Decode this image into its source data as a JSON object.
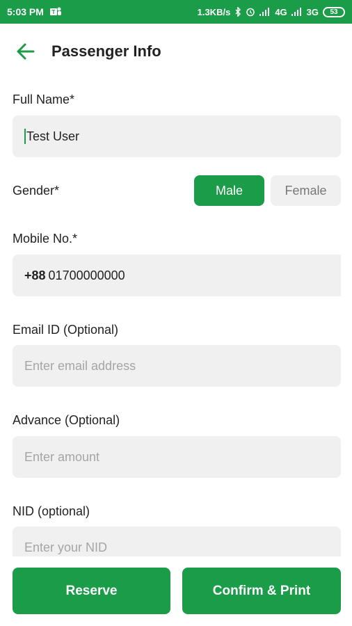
{
  "status_bar": {
    "time": "5:03 PM",
    "net_speed": "1.3KB/s",
    "net1": "4G",
    "net2": "3G",
    "battery": "53"
  },
  "header": {
    "title": "Passenger Info"
  },
  "form": {
    "full_name": {
      "label": "Full Name*",
      "value": "Test User"
    },
    "gender": {
      "label": "Gender*",
      "options": [
        "Male",
        "Female"
      ],
      "selected": "Male"
    },
    "mobile": {
      "label": "Mobile No.*",
      "prefix": "+88",
      "value": "01700000000"
    },
    "email": {
      "label": "Email ID (Optional)",
      "placeholder": "Enter email address"
    },
    "advance": {
      "label": "Advance (Optional)",
      "placeholder": "Enter amount"
    },
    "nid": {
      "label": "NID (optional)",
      "placeholder": "Enter your NID"
    }
  },
  "actions": {
    "reserve": "Reserve",
    "confirm": "Confirm & Print"
  },
  "colors": {
    "accent": "#1a9c48",
    "field_bg": "#f0f0f0",
    "placeholder": "#a5a5a5"
  }
}
